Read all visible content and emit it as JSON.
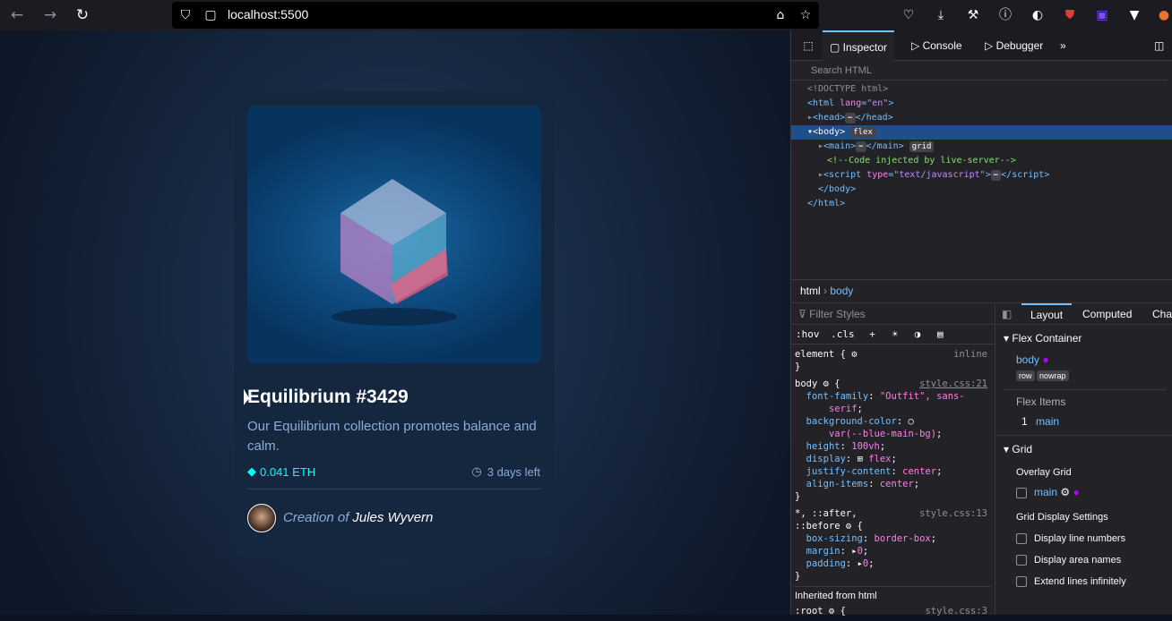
{
  "browser": {
    "url": "localhost:5500"
  },
  "card": {
    "title": "Equilibrium #3429",
    "description": "Our Equilibrium collection promotes balance and calm.",
    "price": "0.041 ETH",
    "time_left": "3 days left",
    "creator_prefix": "Creation of",
    "creator_name": "Jules Wyvern"
  },
  "devtools": {
    "tabs": [
      "Inspector",
      "Console",
      "Debugger"
    ],
    "search_placeholder": "Search HTML",
    "breadcrumb": [
      "html",
      "body"
    ],
    "filter_placeholder": "Filter Styles",
    "pseudo_buttons": [
      ":hov",
      ".cls"
    ],
    "side_tabs": [
      "Layout",
      "Computed",
      "Cha"
    ],
    "layout": {
      "flex_section": "Flex Container",
      "flex_element": "body",
      "flex_badges": [
        "row",
        "nowrap"
      ],
      "flex_items_label": "Flex Items",
      "flex_item_index": "1",
      "flex_item": "main",
      "grid_section": "Grid",
      "overlay_label": "Overlay Grid",
      "overlay_item": "main",
      "settings_label": "Grid Display Settings",
      "settings": [
        "Display line numbers",
        "Display area names",
        "Extend lines infinitely"
      ]
    },
    "inherited_label": "Inherited from html"
  }
}
